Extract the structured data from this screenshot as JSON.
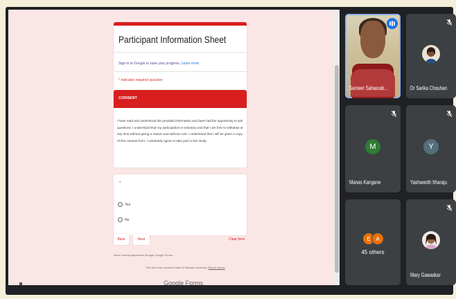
{
  "form": {
    "title": "Participant Information Sheet",
    "signin_text": "Sign in to Google to save your progress.",
    "signin_link": "Learn more",
    "required_note": "* Indicates required question",
    "section_label": "CONSENT",
    "consent_text": "I have read and understood the provided information and have had the opportunity to ask questions. I understand that my participation is voluntary and that I am free to withdraw at any time without giving a reason and without cost. I understand that I will be given a copy of this consent form. I voluntarily agree to take part in this study.",
    "question_marker": "*",
    "options": [
      "Yes",
      "No"
    ],
    "back_label": "Back",
    "next_label": "Next",
    "clear_label": "Clear form",
    "never_submit": "Never submit passwords through Google Forms.",
    "disclaimer": "This form was created inside of Kalinga University.",
    "disclaimer_link": "Report Abuse",
    "footer_brand": "Google Forms"
  },
  "participants": [
    {
      "name": "Sameer Sahasrab...",
      "type": "video",
      "speaking": true
    },
    {
      "name": "Dr Sarika Chouhan",
      "type": "photo",
      "muted": true
    },
    {
      "name": "Manas Kangane",
      "type": "initial",
      "initial": "M",
      "color": "#2e7d32",
      "muted": true
    },
    {
      "name": "Yashwanth Itharaju",
      "type": "initial",
      "initial": "Y",
      "color": "#546e7a",
      "muted": true
    },
    {
      "name": "45 others",
      "type": "group",
      "initials": [
        "E",
        "A"
      ],
      "colors": [
        "#e8710a",
        "#e8710a"
      ]
    },
    {
      "name": "Mary Gawaskar",
      "type": "photo",
      "muted": true
    }
  ],
  "icons": {
    "mic_off": "mic-off-icon",
    "speaking": "audio-level-icon"
  }
}
